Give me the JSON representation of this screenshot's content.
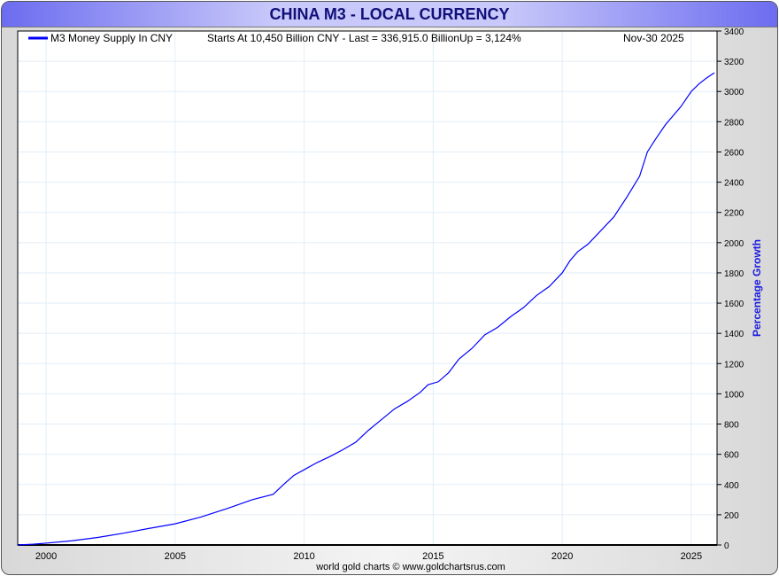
{
  "title": "CHINA M3 - LOCAL CURRENCY",
  "chart_data": {
    "type": "line",
    "title": "CHINA M3 - LOCAL CURRENCY",
    "ylabel": "Percentage Growth",
    "xlabel": "",
    "legend": {
      "label": "M3 Money Supply In CNY",
      "position": "top-left",
      "color": "#0000ff"
    },
    "annotation": "Starts At 10,450 Billion CNY - Last = 336,915.0 BillionUp = 3,124%",
    "date_label": "Nov-30  2025",
    "footer": "world gold charts © www.goldchartsrus.com",
    "xlim": [
      1998.9,
      2026
    ],
    "ylim": [
      0,
      3400
    ],
    "x_ticks": [
      2000,
      2005,
      2010,
      2015,
      2020,
      2025
    ],
    "y_ticks": [
      0,
      200,
      400,
      600,
      800,
      1000,
      1200,
      1400,
      1600,
      1800,
      2000,
      2200,
      2400,
      2600,
      2800,
      3000,
      3200,
      3400
    ],
    "grid": true,
    "series": [
      {
        "name": "M3 Money Supply In CNY",
        "color": "#0000ff",
        "x": [
          1998.9,
          1999.5,
          2000,
          2001,
          2002,
          2003,
          2004,
          2005,
          2006,
          2007,
          2008,
          2008.8,
          2009.2,
          2009.6,
          2010,
          2010.5,
          2011,
          2011.5,
          2012,
          2012.5,
          2013,
          2013.5,
          2014,
          2014.5,
          2014.8,
          2015.2,
          2015.6,
          2016,
          2016.5,
          2017,
          2017.5,
          2018,
          2018.5,
          2019,
          2019.5,
          2020,
          2020.3,
          2020.6,
          2021,
          2021.5,
          2022,
          2022.5,
          2023,
          2023.3,
          2023.6,
          2024,
          2024.3,
          2024.6,
          2025,
          2025.3,
          2025.6,
          2025.9
        ],
        "y": [
          0,
          5,
          12,
          28,
          50,
          78,
          110,
          140,
          185,
          240,
          300,
          335,
          400,
          460,
          498,
          545,
          585,
          630,
          680,
          760,
          830,
          900,
          950,
          1010,
          1060,
          1080,
          1140,
          1230,
          1300,
          1390,
          1440,
          1510,
          1570,
          1650,
          1710,
          1800,
          1880,
          1940,
          1990,
          2080,
          2170,
          2300,
          2440,
          2600,
          2680,
          2780,
          2840,
          2900,
          3000,
          3050,
          3090,
          3124
        ]
      }
    ]
  }
}
